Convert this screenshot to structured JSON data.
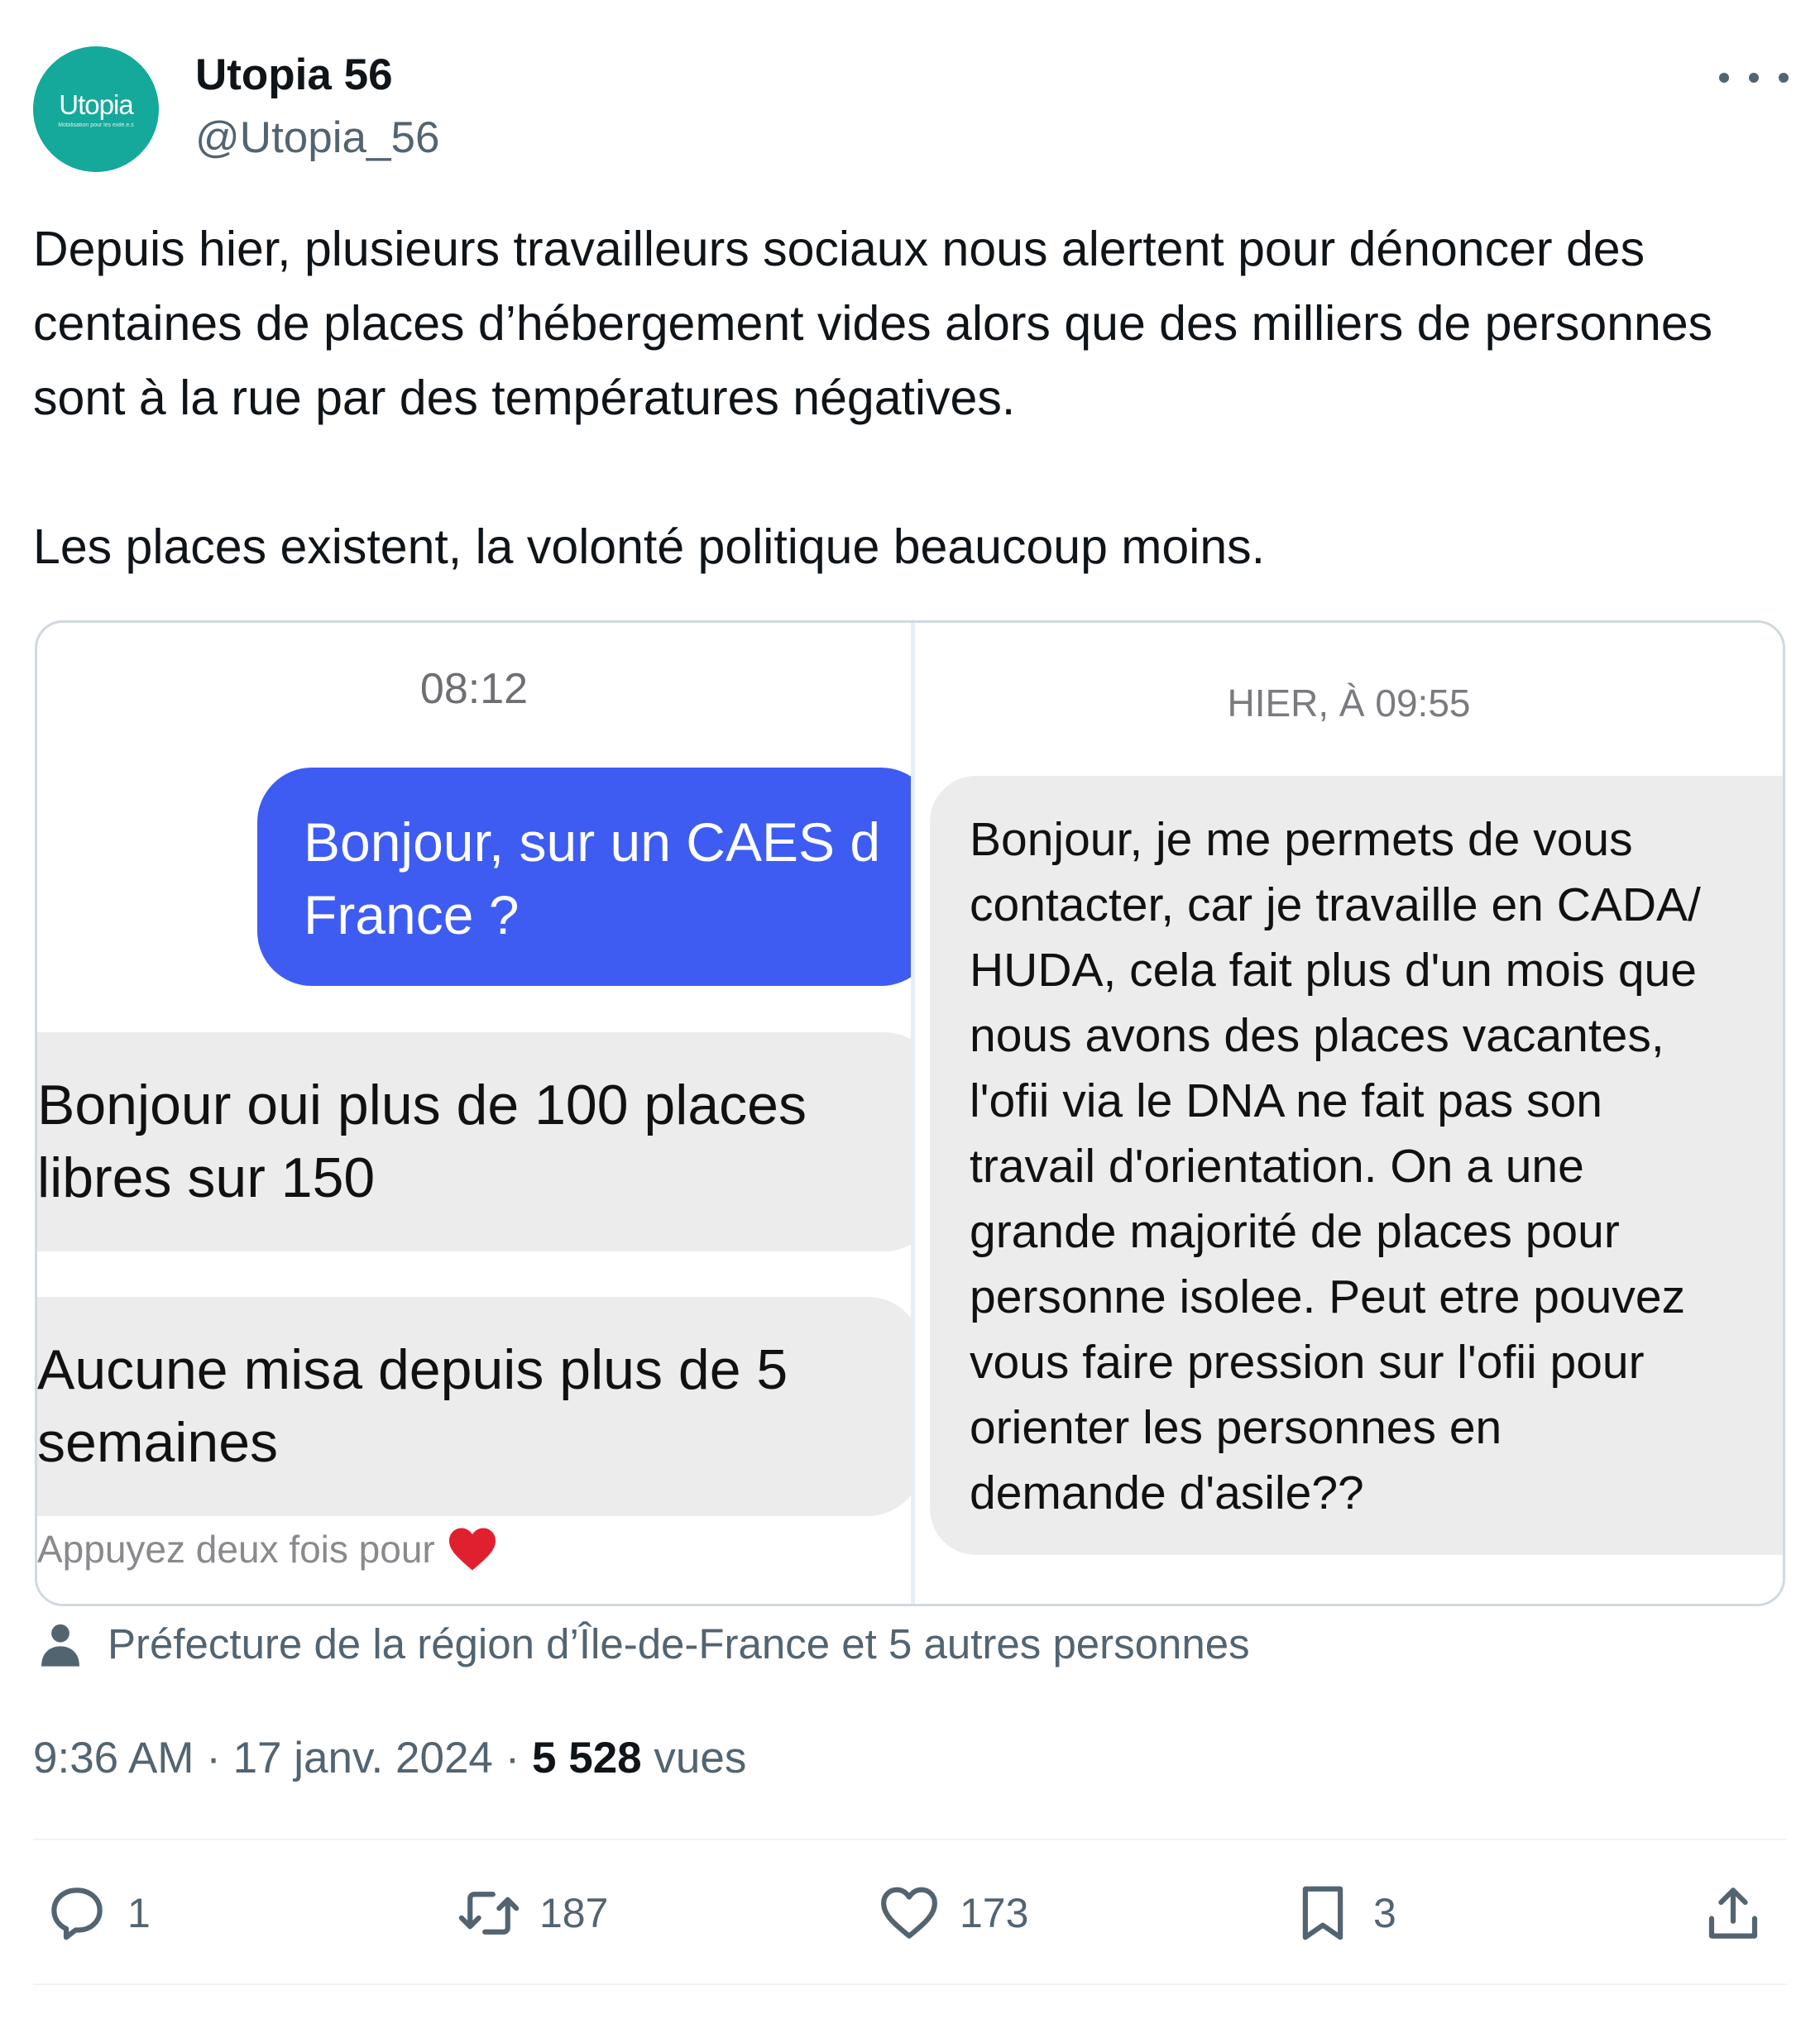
{
  "author": {
    "avatar_logo_text": "Utopia",
    "avatar_logo_subtext": "Mobilisation pour les exilé.e.s",
    "display_name": "Utopia 56",
    "handle": "@Utopia_56"
  },
  "tweet": {
    "paragraphs": [
      "Depuis hier, plusieurs travailleurs sociaux nous alertent pour dénoncer des centaines de places d’hébergement vides alors que des milliers de personnes sont à la rue par des températures négatives.",
      "Les places existent, la volonté politique beaucoup moins."
    ]
  },
  "media": {
    "left": {
      "timestamp": "08:12",
      "sent_line1": "Bonjour, sur un CAES d",
      "sent_line2": "France ?",
      "received_1_line1": "Bonjour oui plus de 100 places",
      "received_1_line2": "libres sur 150",
      "received_2_line1": "Aucune misa depuis plus de 5",
      "received_2_line2": "semaines",
      "hint": "Appuyez deux fois pour"
    },
    "right": {
      "timestamp": "HIER, À 09:55",
      "lines": [
        "Bonjour, je me permets de vous",
        "contacter, car je travaille en CADA/",
        "HUDA, cela fait plus d'un mois que",
        "nous avons des places vacantes,",
        "l'ofii via le DNA ne fait pas son",
        "travail d'orientation. On a une",
        "grande majorité de places pour",
        "personne isolee. Peut etre pouvez",
        "vous faire pression sur l'ofii pour",
        "orienter les personnes en",
        "demande d'asile??"
      ]
    }
  },
  "tagged": "Préfecture de la région d’Île-de-France et 5 autres personnes",
  "meta": {
    "time": "9:36 AM",
    "date": "17 janv. 2024",
    "views_count": "5 528",
    "views_label": "vues"
  },
  "actions": {
    "replies": "1",
    "retweets": "187",
    "likes": "173",
    "bookmarks": "3"
  },
  "colors": {
    "accent_teal": "#14a99a",
    "sent_bubble": "#3e5cf2",
    "heart": "#e0202e"
  }
}
